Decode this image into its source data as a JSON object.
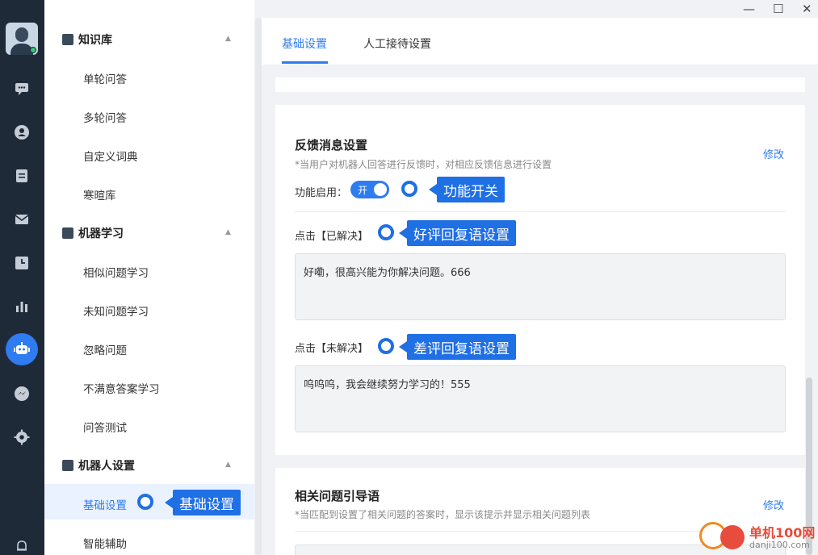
{
  "rail": {
    "icons": [
      "chat-icon",
      "contact-icon",
      "doc-icon",
      "mail-icon",
      "clock-icon",
      "chart-icon",
      "robot-icon",
      "messenger-icon",
      "gear-icon",
      "bell-icon"
    ]
  },
  "nav": {
    "groups": [
      {
        "label": "知识库",
        "items": [
          "单轮问答",
          "多轮问答",
          "自定义词典",
          "寒暄库"
        ]
      },
      {
        "label": "机器学习",
        "items": [
          "相似问题学习",
          "未知问题学习",
          "忽略问题",
          "不满意答案学习",
          "问答测试"
        ]
      },
      {
        "label": "机器人设置",
        "items": [
          "基础设置",
          "智能辅助"
        ]
      }
    ],
    "active_item": "基础设置"
  },
  "tabs": [
    {
      "label": "基础设置",
      "active": true
    },
    {
      "label": "人工接待设置",
      "active": false
    }
  ],
  "feedback_section": {
    "title": "反馈消息设置",
    "desc": "*当用户对机器人回答进行反馈时，对相应反馈信息进行设置",
    "edit": "修改",
    "enable_label": "功能启用：",
    "toggle_text": "开",
    "resolved_label": "点击【已解决】",
    "resolved_text": "好嘞，很高兴能为你解决问题。666",
    "unresolved_label": "点击【未解决】",
    "unresolved_text": "呜呜呜，我会继续努力学习的！555"
  },
  "related_section": {
    "title": "相关问题引导语",
    "desc": "*当匹配到设置了相关问题的答案时，显示该提示并显示相关问题列表",
    "edit": "修改"
  },
  "callouts": {
    "switch": "功能开关",
    "good": "好评回复语设置",
    "bad": "差评回复语设置",
    "basic": "基础设置"
  },
  "watermark": {
    "cn": "单机100网",
    "url": "danji100.com"
  },
  "colors": {
    "accent": "#2f7bf0",
    "rail": "#1e2a38"
  }
}
